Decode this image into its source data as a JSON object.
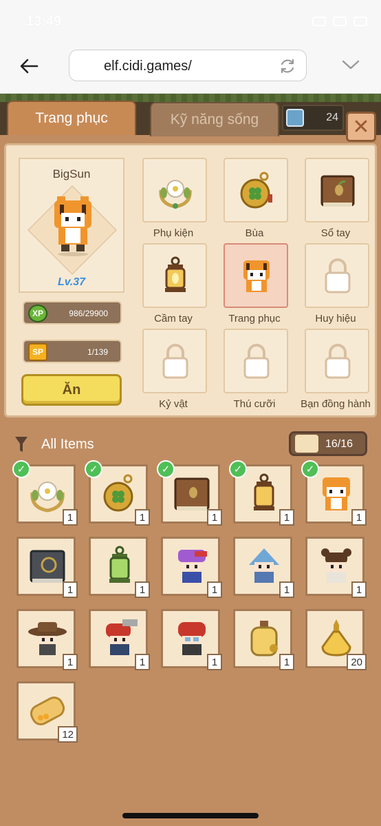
{
  "status_bar": {
    "time": "13:49"
  },
  "browser": {
    "url": "elf.cidi.games/"
  },
  "tabs": [
    {
      "label": "Trang phục",
      "active": true
    },
    {
      "label": "Kỹ năng sống",
      "active": false
    }
  ],
  "tab_extra_value": "24",
  "character": {
    "name": "BigSun",
    "level": "Lv.37",
    "xp_label": "XP",
    "xp": "986/29900",
    "sp_label": "SP",
    "sp": "1/139",
    "eat_button": "Ăn"
  },
  "equipment_slots": [
    {
      "label": "Phụ kiện",
      "icon": "wreath-icon",
      "selected": false
    },
    {
      "label": "Bùa",
      "icon": "clover-amulet-icon",
      "selected": false
    },
    {
      "label": "Sổ tay",
      "icon": "book-icon",
      "selected": false
    },
    {
      "label": "Cầm tay",
      "icon": "lantern-icon",
      "selected": false
    },
    {
      "label": "Trang phục",
      "icon": "tiger-costume-icon",
      "selected": true
    },
    {
      "label": "Huy hiệu",
      "icon": "lock-icon",
      "selected": false
    },
    {
      "label": "Kỷ vật",
      "icon": "lock-icon",
      "selected": false
    },
    {
      "label": "Thú cưỡi",
      "icon": "lock-icon",
      "selected": false
    },
    {
      "label": "Bạn đồng hành",
      "icon": "lock-icon",
      "selected": false
    }
  ],
  "inventory": {
    "title": "All Items",
    "count": "16/16",
    "items": [
      {
        "icon": "wreath-icon",
        "qty": "1",
        "equipped": true
      },
      {
        "icon": "clover-amulet-icon",
        "qty": "1",
        "equipped": true
      },
      {
        "icon": "book-icon",
        "qty": "1",
        "equipped": true
      },
      {
        "icon": "lantern-icon",
        "qty": "1",
        "equipped": true
      },
      {
        "icon": "tiger-costume-icon",
        "qty": "1",
        "equipped": true
      },
      {
        "icon": "dark-book-icon",
        "qty": "1",
        "equipped": false
      },
      {
        "icon": "green-lantern-icon",
        "qty": "1",
        "equipped": false
      },
      {
        "icon": "purple-hat-costume-icon",
        "qty": "1",
        "equipped": false
      },
      {
        "icon": "blue-hood-costume-icon",
        "qty": "1",
        "equipped": false
      },
      {
        "icon": "bun-hair-costume-icon",
        "qty": "1",
        "equipped": false
      },
      {
        "icon": "cowboy-hat-costume-icon",
        "qty": "1",
        "equipped": false
      },
      {
        "icon": "chainsaw-helmet-costume-icon",
        "qty": "1",
        "equipped": false
      },
      {
        "icon": "red-helmet-costume-icon",
        "qty": "1",
        "equipped": false
      },
      {
        "icon": "potion-bottle-icon",
        "qty": "1",
        "equipped": false
      },
      {
        "icon": "gold-potion-icon",
        "qty": "20",
        "equipped": false
      },
      {
        "icon": "bread-roll-icon",
        "qty": "12",
        "equipped": false
      }
    ]
  },
  "colors": {
    "panel": "#f4e3c8",
    "background": "#c08d63",
    "check": "#4fbf56",
    "level": "#3b8de0"
  }
}
